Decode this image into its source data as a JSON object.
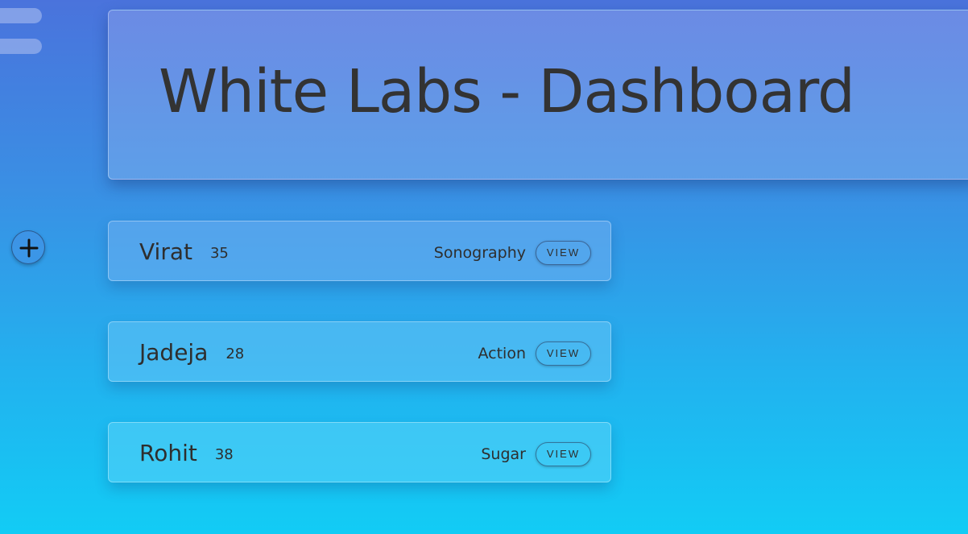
{
  "header": {
    "title": "White Labs - Dashboard"
  },
  "icons": {
    "menu": "hamburger-menu-icon",
    "add": "plus-icon"
  },
  "colors": {
    "background_top": "#4a73dc",
    "background_bottom": "#12ccf5",
    "text": "#333333"
  },
  "patients": [
    {
      "name": "Virat",
      "age": "35",
      "test": "Sonography",
      "action": "VIEW"
    },
    {
      "name": "Jadeja",
      "age": "28",
      "test": "Action",
      "action": "VIEW"
    },
    {
      "name": "Rohit",
      "age": "38",
      "test": "Sugar",
      "action": "VIEW"
    }
  ]
}
